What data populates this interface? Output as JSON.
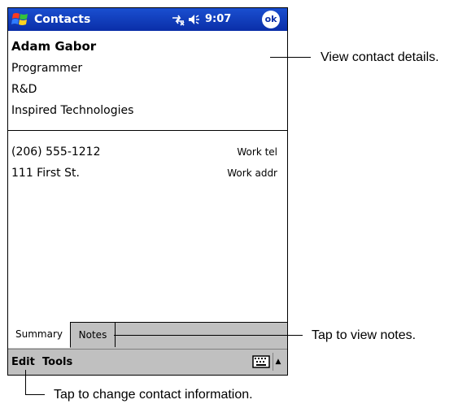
{
  "titlebar": {
    "app_title": "Contacts",
    "time": "9:07",
    "ok_label": "ok",
    "connectivity_icon": "connectivity-icon",
    "volume_icon": "speaker-icon",
    "start_icon": "windows-flag-icon",
    "bar_color": "#0a2ea8"
  },
  "contact": {
    "name": "Adam Gabor",
    "job_title": "Programmer",
    "department": "R&D",
    "company": "Inspired Technologies"
  },
  "details": [
    {
      "value": "(206) 555-1212",
      "label": "Work tel"
    },
    {
      "value": "111 First St.",
      "label": "Work addr"
    }
  ],
  "tabs": [
    {
      "label": "Summary",
      "selected": true
    },
    {
      "label": "Notes",
      "selected": false
    }
  ],
  "menubar": {
    "edit_label": "Edit",
    "tools_label": "Tools",
    "keyboard_icon": "keyboard-icon",
    "sip_arrow": "▲"
  },
  "callouts": {
    "details": "View contact details.",
    "notes": "Tap to view notes.",
    "edit": "Tap to change contact information."
  }
}
